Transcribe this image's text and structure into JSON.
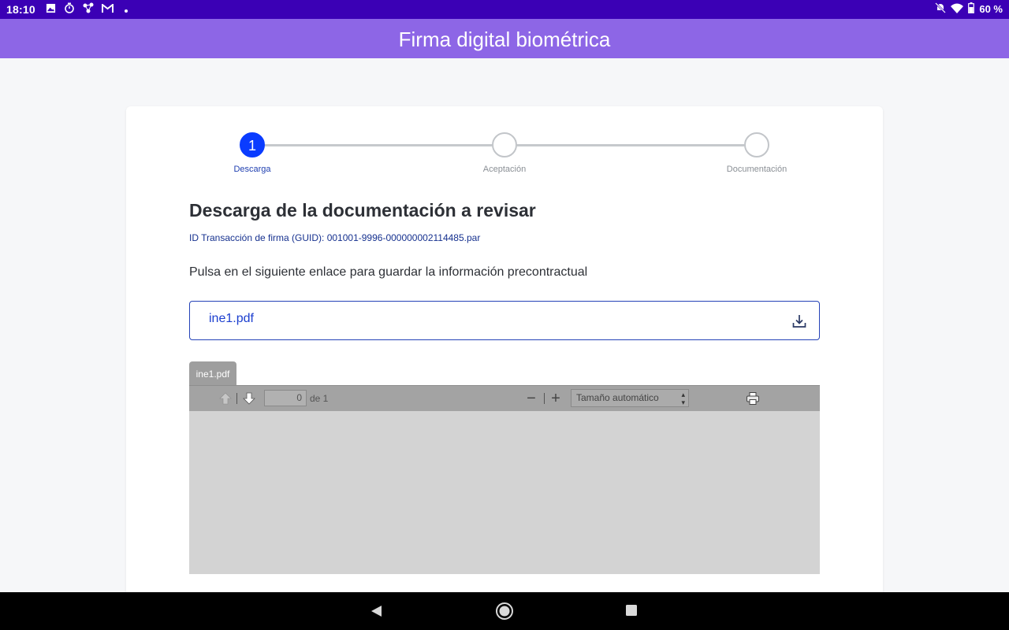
{
  "status_bar": {
    "time": "18:10",
    "battery": "60 %",
    "notification_icons": [
      "image-icon",
      "timer-icon",
      "share-icon",
      "gmail-icon",
      "dot-icon"
    ],
    "system_icons": [
      "bell-off-icon",
      "wifi-icon",
      "battery-icon"
    ]
  },
  "app_bar": {
    "title": "Firma digital biométrica"
  },
  "stepper": {
    "steps": [
      {
        "number": "1",
        "label": "Descarga",
        "active": true
      },
      {
        "number": "",
        "label": "Aceptación",
        "active": false
      },
      {
        "number": "",
        "label": "Documentación",
        "active": false
      }
    ]
  },
  "content": {
    "heading": "Descarga de la documentación a revisar",
    "guid_text": "ID Transacción de firma (GUID): 001001-9996-000000002114485.par",
    "instructions": "Pulsa en el siguiente enlace para guardar la información precontractual",
    "download": {
      "filename": "ine1.pdf",
      "icon": "download-icon"
    }
  },
  "pdf_viewer": {
    "tab_label": "ine1.pdf",
    "page_value": "0",
    "page_count": "de 1",
    "zoom_out": "−",
    "zoom_in": "+",
    "zoom_selected": "Tamaño automático"
  },
  "colors": {
    "status_bar": "#3b00b5",
    "app_bar": "#8d66e6",
    "accent": "#0a3cff",
    "link": "#1c3fcf"
  }
}
